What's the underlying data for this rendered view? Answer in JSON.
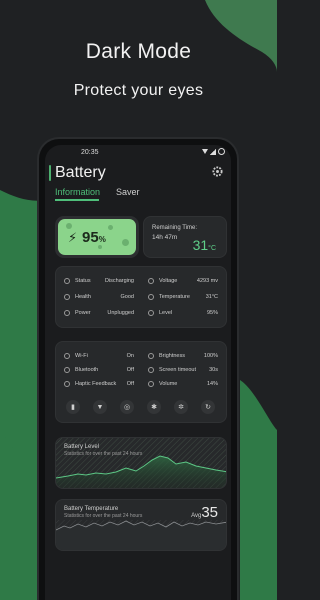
{
  "promo": {
    "title": "Dark Mode",
    "subtitle": "Protect your eyes"
  },
  "status_bar": {
    "time": "20:35"
  },
  "app": {
    "title": "Battery",
    "tabs": [
      {
        "label": "Information",
        "active": true
      },
      {
        "label": "Saver",
        "active": false
      }
    ]
  },
  "battery": {
    "percent": "95",
    "percent_unit": "%",
    "remaining_label": "Remaining Time:",
    "remaining_value": "14h 47m",
    "temperature": "31",
    "temperature_unit": "°C"
  },
  "info": {
    "left": [
      {
        "label": "Status",
        "value": "Discharging"
      },
      {
        "label": "Health",
        "value": "Good"
      },
      {
        "label": "Power",
        "value": "Unplugged"
      }
    ],
    "right": [
      {
        "label": "Voltage",
        "value": "4293 mv"
      },
      {
        "label": "Temperature",
        "value": "31°C"
      },
      {
        "label": "Level",
        "value": "95%"
      }
    ]
  },
  "quick_settings": {
    "left": [
      {
        "label": "Wi-Fi",
        "value": "On"
      },
      {
        "label": "Bluetooth",
        "value": "Off"
      },
      {
        "label": "Haptic Feedback",
        "value": "Off"
      }
    ],
    "right": [
      {
        "label": "Brightness",
        "value": "100%"
      },
      {
        "label": "Screen timeout",
        "value": "30s"
      },
      {
        "label": "Volume",
        "value": "14%"
      }
    ],
    "buttons": [
      "sd-card-icon",
      "wifi-icon",
      "hotspot-icon",
      "bluetooth-icon",
      "gear-icon",
      "rotate-icon"
    ]
  },
  "charts": {
    "level": {
      "title": "Battery Level",
      "subtitle": "Statistics for over the past 24 hours"
    },
    "temperature": {
      "title": "Battery Temperature",
      "subtitle": "Statistics for over the past 24 hours",
      "avg_label": "Avg",
      "avg_value": "35"
    }
  },
  "colors": {
    "accent": "#4fbf7a",
    "background": "#1f2123",
    "battery_fill": "#8bd48b"
  }
}
